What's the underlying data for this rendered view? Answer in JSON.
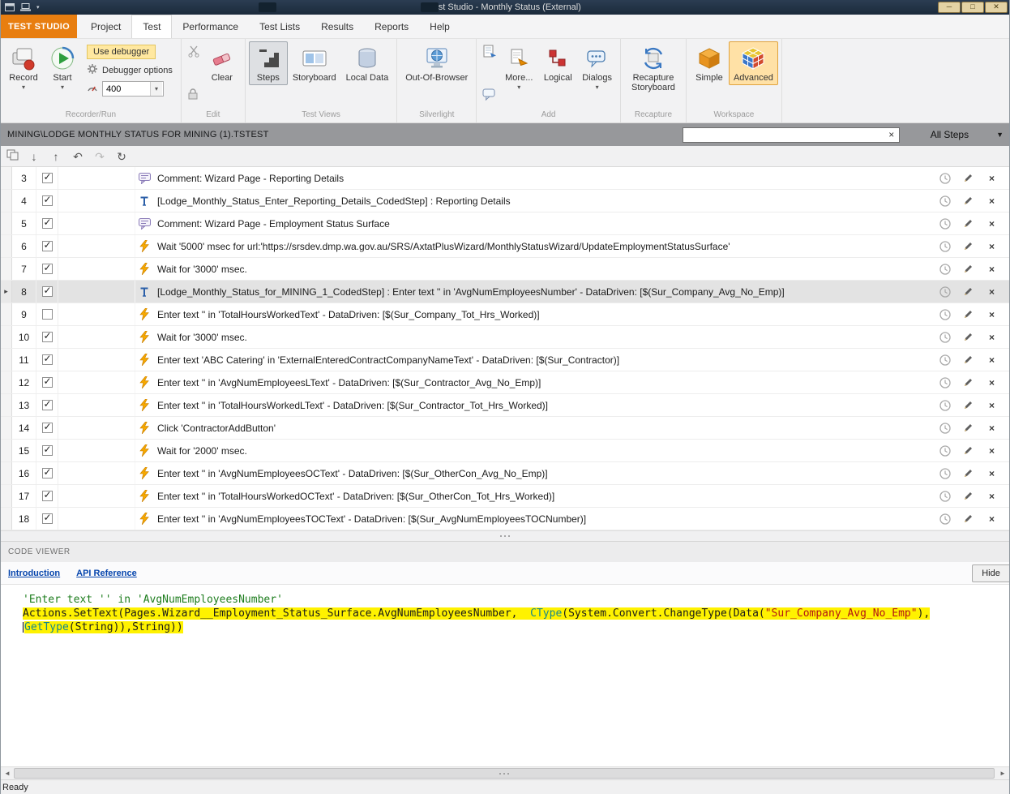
{
  "window": {
    "title": "Test Studio - Monthly Status (External)"
  },
  "menubar": {
    "app_button": "TEST STUDIO",
    "tabs": [
      {
        "label": "Project",
        "active": false
      },
      {
        "label": "Test",
        "active": true
      },
      {
        "label": "Performance",
        "active": false
      },
      {
        "label": "Test Lists",
        "active": false
      },
      {
        "label": "Results",
        "active": false
      },
      {
        "label": "Reports",
        "active": false
      },
      {
        "label": "Help",
        "active": false
      }
    ]
  },
  "ribbon": {
    "record": "Record",
    "start": "Start",
    "use_debugger": "Use debugger",
    "debugger_options": "Debugger options",
    "speed_value": "400",
    "clear": "Clear",
    "steps": "Steps",
    "storyboard": "Storyboard",
    "local_data": "Local Data",
    "out_of_browser": "Out-Of-Browser",
    "more": "More...",
    "logical": "Logical",
    "dialogs": "Dialogs",
    "recapture_storyboard": "Recapture Storyboard",
    "simple": "Simple",
    "advanced": "Advanced",
    "group_labels": {
      "recorder_run": "Recorder/Run",
      "edit": "Edit",
      "test_views": "Test Views",
      "silverlight": "Silverlight",
      "add": "Add",
      "recapture": "Recapture",
      "workspace": "Workspace"
    }
  },
  "pathbar": {
    "path": "MINING\\LODGE MONTHLY STATUS FOR MINING (1).TSTEST",
    "filter_value": "",
    "clear_glyph": "×",
    "scope": "All Steps"
  },
  "steps": [
    {
      "num": 3,
      "type": "comment",
      "checked": true,
      "selected": false,
      "text": "Comment: Wizard Page - Reporting Details"
    },
    {
      "num": 4,
      "type": "coded",
      "checked": true,
      "selected": false,
      "text": "[Lodge_Monthly_Status_Enter_Reporting_Details_CodedStep] : Reporting Details"
    },
    {
      "num": 5,
      "type": "comment",
      "checked": true,
      "selected": false,
      "text": "Comment: Wizard Page - Employment Status Surface"
    },
    {
      "num": 6,
      "type": "action",
      "checked": true,
      "selected": false,
      "text": "Wait '5000' msec for url:'https://srsdev.dmp.wa.gov.au/SRS/AxtatPlusWizard/MonthlyStatusWizard/UpdateEmploymentStatusSurface'"
    },
    {
      "num": 7,
      "type": "action",
      "checked": true,
      "selected": false,
      "text": "Wait for '3000' msec."
    },
    {
      "num": 8,
      "type": "coded",
      "checked": true,
      "selected": true,
      "text": "[Lodge_Monthly_Status_for_MINING_1_CodedStep] : Enter text '' in 'AvgNumEmployeesNumber' - DataDriven: [$(Sur_Company_Avg_No_Emp)]"
    },
    {
      "num": 9,
      "type": "action",
      "checked": false,
      "selected": false,
      "text": "Enter text '' in 'TotalHoursWorkedText' - DataDriven: [$(Sur_Company_Tot_Hrs_Worked)]"
    },
    {
      "num": 10,
      "type": "action",
      "checked": true,
      "selected": false,
      "text": "Wait for '3000' msec."
    },
    {
      "num": 11,
      "type": "action",
      "checked": true,
      "selected": false,
      "text": "Enter text 'ABC Catering' in 'ExternalEnteredContractCompanyNameText' - DataDriven: [$(Sur_Contractor)]"
    },
    {
      "num": 12,
      "type": "action",
      "checked": true,
      "selected": false,
      "text": "Enter text '' in 'AvgNumEmployeesLText' - DataDriven: [$(Sur_Contractor_Avg_No_Emp)]"
    },
    {
      "num": 13,
      "type": "action",
      "checked": true,
      "selected": false,
      "text": "Enter text '' in 'TotalHoursWorkedLText' - DataDriven: [$(Sur_Contractor_Tot_Hrs_Worked)]"
    },
    {
      "num": 14,
      "type": "action",
      "checked": true,
      "selected": false,
      "text": "Click 'ContractorAddButton'"
    },
    {
      "num": 15,
      "type": "action",
      "checked": true,
      "selected": false,
      "text": "Wait for '2000' msec."
    },
    {
      "num": 16,
      "type": "action",
      "checked": true,
      "selected": false,
      "text": "Enter text '' in 'AvgNumEmployeesOCText' - DataDriven: [$(Sur_OtherCon_Avg_No_Emp)]"
    },
    {
      "num": 17,
      "type": "action",
      "checked": true,
      "selected": false,
      "text": "Enter text '' in 'TotalHoursWorkedOCText' - DataDriven: [$(Sur_OtherCon_Tot_Hrs_Worked)]"
    },
    {
      "num": 18,
      "type": "action",
      "checked": true,
      "selected": false,
      "text": "Enter text '' in 'AvgNumEmployeesTOCText' - DataDriven: [$(Sur_AvgNumEmployeesTOCNumber)]"
    }
  ],
  "code_viewer": {
    "header": "CODE VIEWER",
    "link_introduction": "Introduction",
    "link_api_reference": "API Reference",
    "hide": "Hide",
    "comment": "'Enter text '' in 'AvgNumEmployeesNumber'",
    "code_lines": [
      {
        "tokens": [
          {
            "t": "Actions.SetText(Pages.Wizard__Employment_Status_Surface.AvgNumEmployeesNumber,  ",
            "c": "plain"
          },
          {
            "t": "CType",
            "c": "keyword"
          },
          {
            "t": "(System.Convert.ChangeType(Data(",
            "c": "plain"
          },
          {
            "t": "\"Sur_Company_Avg_No_Emp\"",
            "c": "string"
          },
          {
            "t": "),",
            "c": "plain"
          }
        ]
      },
      {
        "tokens": [
          {
            "t": "GetType",
            "c": "keyword"
          },
          {
            "t": "(String)),String))",
            "c": "plain"
          }
        ]
      }
    ]
  },
  "statusbar": {
    "text": "Ready"
  },
  "colors": {
    "accent_orange": "#E87E10",
    "highlight_yellow": "#FFF200",
    "comment_green": "#1E7D1E",
    "string_red": "#B31515",
    "keyword_teal": "#16878C",
    "titlebar_navy": "#1C2B3C",
    "selected_row_gray": "#E3E3E3"
  }
}
